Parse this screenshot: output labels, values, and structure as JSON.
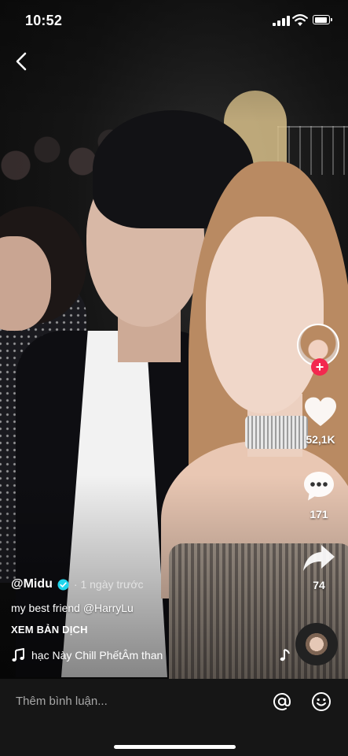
{
  "status_bar": {
    "time": "10:52",
    "battery_level": 0.9
  },
  "video": {
    "user_handle": "@Midu",
    "posted_ago": "· 1 ngày trước",
    "description_prefix": "my best friend ",
    "description_mention": "@HarryLu",
    "translate_label": "XEM BẢN DỊCH",
    "music_text": "hạc Này Chill PhếtÂm than"
  },
  "actions": {
    "like_count": "52,1K",
    "comment_count": "171",
    "share_count": "74"
  },
  "icons": {
    "back": "chevron-left-icon",
    "like": "heart-icon",
    "comment": "speech-bubble-icon",
    "share": "share-arrow-icon",
    "follow": "plus-icon",
    "music": "music-note-icon",
    "mention": "at-sign-icon",
    "emoji": "smiley-icon"
  },
  "follow_symbol": "+",
  "comment_bar": {
    "placeholder": "Thêm bình luận..."
  },
  "colors": {
    "follow_red": "#f3284f",
    "verified_blue": "#20d5ec",
    "bottom_bar": "#161616"
  }
}
